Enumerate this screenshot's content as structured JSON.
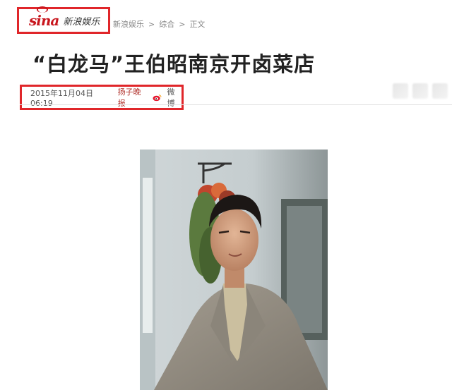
{
  "header": {
    "logo": {
      "wordmark": "sina",
      "name": "新浪娱乐"
    },
    "breadcrumb": [
      "新浪娱乐",
      ">",
      "综合",
      ">",
      "正文"
    ]
  },
  "article": {
    "title": "“白龙马”王伯昭南京开卤菜店",
    "date": "2015年11月04日 06:19",
    "source": "扬子晚报",
    "weibo_label": "微博"
  },
  "colors": {
    "highlight_border": "#e0262a",
    "brand_red": "#c8161d",
    "source_text": "#b0312b"
  },
  "icons": [
    "weibo-icon"
  ]
}
